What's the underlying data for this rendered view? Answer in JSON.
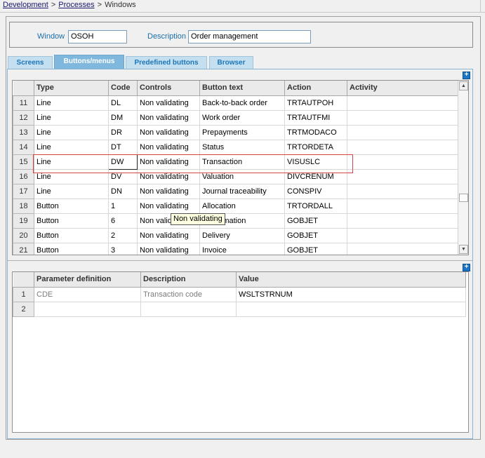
{
  "breadcrumb": {
    "items": [
      "Development",
      "Processes"
    ],
    "current": "Windows",
    "separator": ">"
  },
  "header": {
    "window_label": "Window",
    "window_value": "OSOH",
    "description_label": "Description",
    "description_value": "Order management"
  },
  "tabs": [
    {
      "label": "Screens",
      "active": false
    },
    {
      "label": "Buttons/menus",
      "active": true
    },
    {
      "label": "Predefined buttons",
      "active": false
    },
    {
      "label": "Browser",
      "active": false
    }
  ],
  "plus_icon_glyph": "+",
  "grid": {
    "columns": [
      "Type",
      "Code",
      "Controls",
      "Button text",
      "Action",
      "Activity"
    ],
    "rows": [
      {
        "num": "11",
        "type": "Line",
        "code": "DL",
        "controls": "Non validating",
        "text": "Back-to-back order",
        "action": "TRTAUTPOH",
        "activity": ""
      },
      {
        "num": "12",
        "type": "Line",
        "code": "DM",
        "controls": "Non validating",
        "text": "Work order",
        "action": "TRTAUTFMI",
        "activity": ""
      },
      {
        "num": "13",
        "type": "Line",
        "code": "DR",
        "controls": "Non validating",
        "text": "Prepayments",
        "action": "TRTMODACO",
        "activity": ""
      },
      {
        "num": "14",
        "type": "Line",
        "code": "DT",
        "controls": "Non validating",
        "text": "Status",
        "action": "TRTORDETA",
        "activity": ""
      },
      {
        "num": "15",
        "type": "Line",
        "code": "DW",
        "controls": "Non validating",
        "text": "Transaction",
        "action": "VISUSLC",
        "activity": ""
      },
      {
        "num": "16",
        "type": "Line",
        "code": "DV",
        "controls": "Non validating",
        "text": "Valuation",
        "action": "DIVCRENUM",
        "activity": ""
      },
      {
        "num": "17",
        "type": "Line",
        "code": "DN",
        "controls": "Non validating",
        "text": "Journal traceability",
        "action": "CONSPIV",
        "activity": ""
      },
      {
        "num": "18",
        "type": "Button",
        "code": "1",
        "controls": "Non validating",
        "text": "Allocation",
        "action": "TRTORDALL",
        "activity": ""
      },
      {
        "num": "19",
        "type": "Button",
        "code": "6",
        "controls": "Non validating",
        "text": "Confirmation",
        "action": "GOBJET",
        "activity": ""
      },
      {
        "num": "20",
        "type": "Button",
        "code": "2",
        "controls": "Non validating",
        "text": "Delivery",
        "action": "GOBJET",
        "activity": ""
      },
      {
        "num": "21",
        "type": "Button",
        "code": "3",
        "controls": "Non validating",
        "text": "Invoice",
        "action": "GOBJET",
        "activity": ""
      }
    ],
    "selected_row": "15",
    "tooltip": "Non validating"
  },
  "param_grid": {
    "columns": [
      "Parameter definition",
      "Description",
      "Value"
    ],
    "rows": [
      {
        "num": "1",
        "param": "CDE",
        "desc": "Transaction code",
        "value": "WSLTSTRNUM"
      },
      {
        "num": "2",
        "param": "",
        "desc": "",
        "value": ""
      }
    ]
  }
}
